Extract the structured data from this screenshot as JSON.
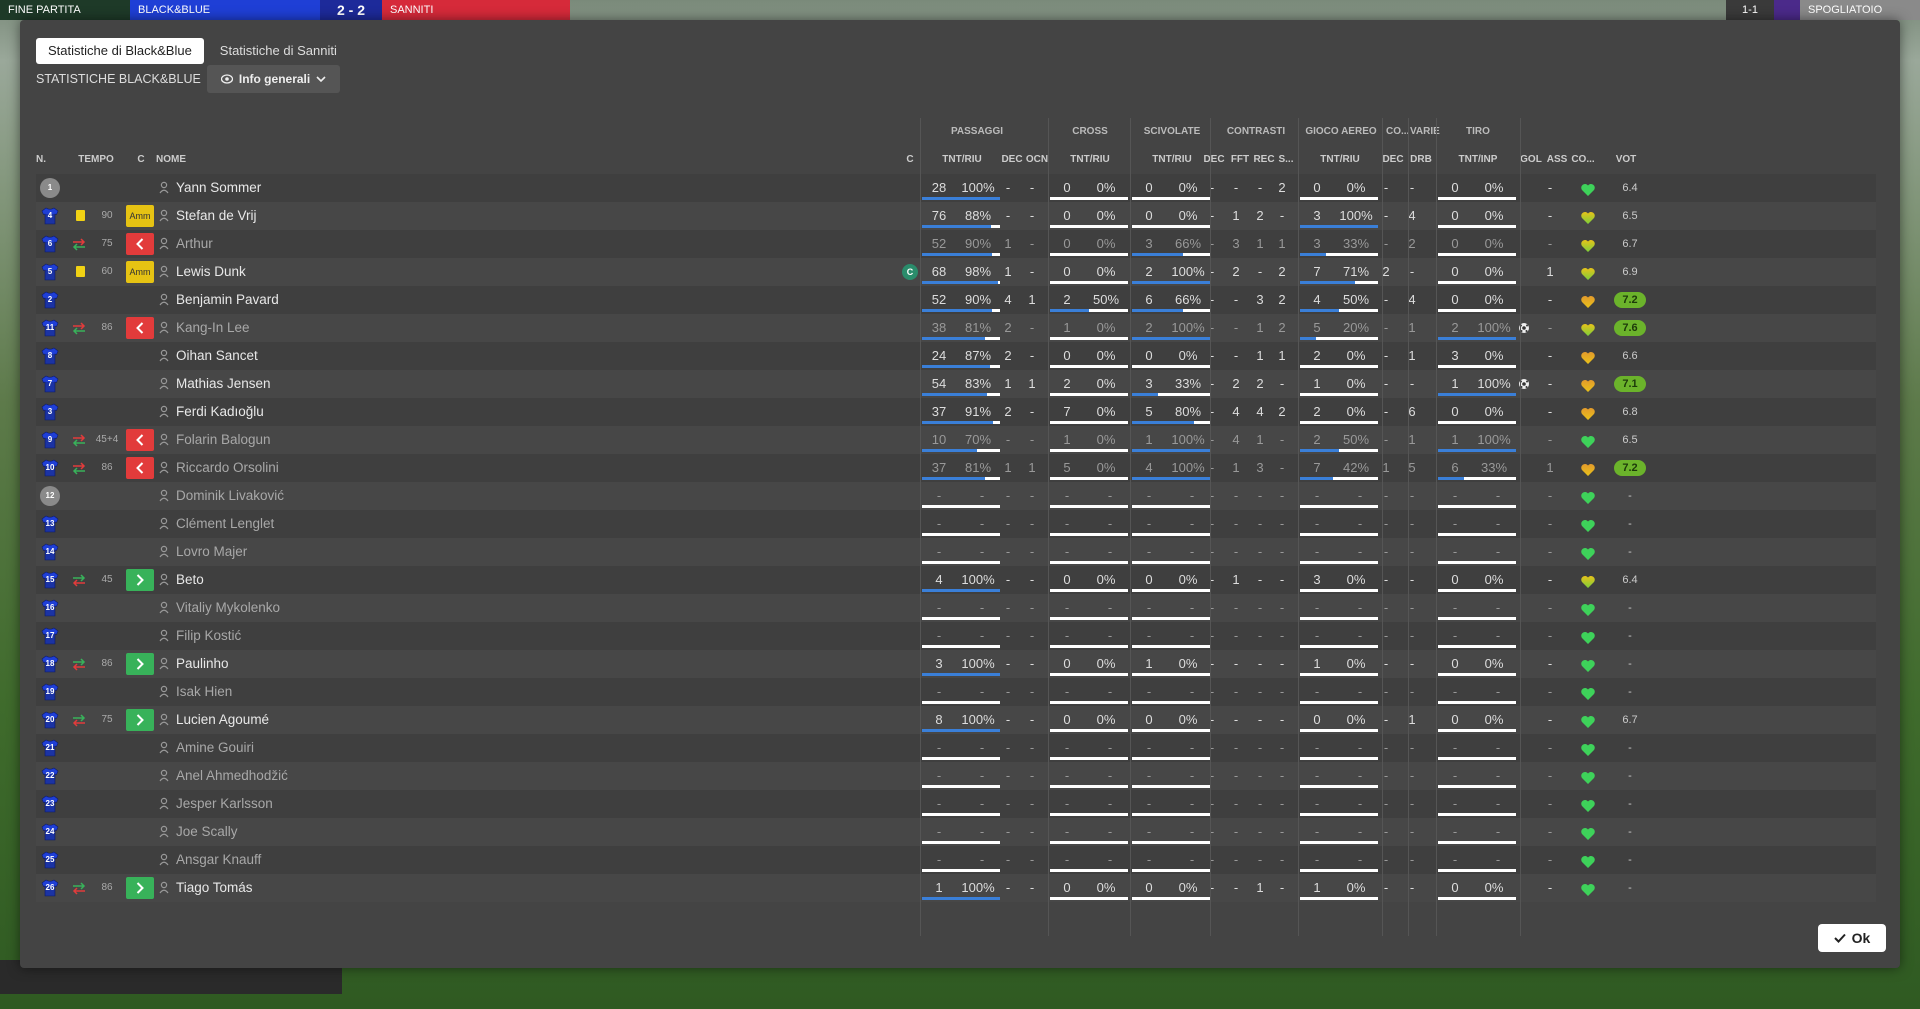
{
  "topbar": {
    "left_label": "FINE PARTITA",
    "team1": "BLACK&BLUE",
    "score": "2 - 2",
    "team2": "SANNITI",
    "right_label": "SPOGLIATOIO",
    "right_small": "1-1"
  },
  "tabs": [
    {
      "label": "Statistiche di Black&Blue",
      "active": true
    },
    {
      "label": "Statistiche di Sanniti",
      "active": false
    }
  ],
  "section_title": "STATISTICHE BLACK&BLUE",
  "view_dropdown": "Info generali",
  "groups": [
    "PASSAGGI",
    "CROSS",
    "SCIVOLATE",
    "CONTRASTI",
    "GIOCO AEREO",
    "CO...",
    "VARIE",
    "TIRO"
  ],
  "headers": {
    "num": "N.",
    "tempo": "TEMPO",
    "c": "C",
    "nome": "NOME",
    "c2": "C",
    "pass": "TNT/RIU",
    "dec1": "DEC",
    "ocn": "OCN",
    "cross": "TNT/RIU",
    "sciv": "TNT/RIU",
    "cdec": "DEC",
    "fft": "FFT",
    "rec": "REC",
    "s": "S...",
    "aereo": "TNT/RIU",
    "codec": "DEC",
    "drb": "DRB",
    "tiro": "TNT/INP",
    "gol": "GOL",
    "ass": "ASS",
    "con": "CO...",
    "vot": "VOT"
  },
  "players": [
    {
      "n": "1",
      "kind": "gk",
      "card": "",
      "sub": "",
      "min": "",
      "status": "",
      "name": "Yann Sommer",
      "dim": false,
      "cap": "",
      "pt": "28",
      "pp": "100%",
      "pf": 1.0,
      "dec1": "-",
      "ocn": "-",
      "ct": "0",
      "cp": "0%",
      "cf": 0,
      "st": "0",
      "sp": "0%",
      "sf": 0,
      "cdec": "-",
      "fft": "-",
      "rec": "-",
      "s": "2",
      "at": "0",
      "ap": "0%",
      "af": 0,
      "codec": "-",
      "drb": "-",
      "tt": "0",
      "tp": "0%",
      "tf": 0,
      "gol": "",
      "ass": "-",
      "heart": "green",
      "vot": "6.4",
      "good": false
    },
    {
      "n": "4",
      "kind": "shirt",
      "card": "y",
      "sub": "",
      "min": "90",
      "status": "amm",
      "name": "Stefan de Vrij",
      "dim": false,
      "cap": "",
      "pt": "76",
      "pp": "88%",
      "pf": 0.88,
      "dec1": "-",
      "ocn": "-",
      "ct": "0",
      "cp": "0%",
      "cf": 0,
      "st": "0",
      "sp": "0%",
      "sf": 0,
      "cdec": "-",
      "fft": "1",
      "rec": "2",
      "s": "-",
      "at": "3",
      "ap": "100%",
      "af": 1,
      "codec": "-",
      "drb": "4",
      "tt": "0",
      "tp": "0%",
      "tf": 0,
      "gol": "",
      "ass": "-",
      "heart": "yellow",
      "vot": "6.5",
      "good": false
    },
    {
      "n": "6",
      "kind": "shirt",
      "card": "",
      "sub": "out",
      "min": "75",
      "status": "out",
      "name": "Arthur",
      "dim": true,
      "cap": "",
      "pt": "52",
      "pp": "90%",
      "pf": 0.9,
      "dec1": "1",
      "ocn": "-",
      "ct": "0",
      "cp": "0%",
      "cf": 0,
      "st": "3",
      "sp": "66%",
      "sf": 0.66,
      "cdec": "-",
      "fft": "3",
      "rec": "1",
      "s": "1",
      "at": "3",
      "ap": "33%",
      "af": 0.33,
      "codec": "-",
      "drb": "2",
      "tt": "0",
      "tp": "0%",
      "tf": 0,
      "gol": "",
      "ass": "-",
      "heart": "yellow",
      "vot": "6.7",
      "good": false
    },
    {
      "n": "5",
      "kind": "shirt",
      "card": "y",
      "sub": "",
      "min": "60",
      "status": "amm",
      "name": "Lewis Dunk",
      "dim": false,
      "cap": "C",
      "pt": "68",
      "pp": "98%",
      "pf": 0.98,
      "dec1": "1",
      "ocn": "-",
      "ct": "0",
      "cp": "0%",
      "cf": 0,
      "st": "2",
      "sp": "100%",
      "sf": 1,
      "cdec": "-",
      "fft": "2",
      "rec": "-",
      "s": "2",
      "at": "7",
      "ap": "71%",
      "af": 0.71,
      "codec": "2",
      "drb": "-",
      "tt": "0",
      "tp": "0%",
      "tf": 0,
      "gol": "",
      "ass": "1",
      "heart": "yellow",
      "vot": "6.9",
      "good": false
    },
    {
      "n": "2",
      "kind": "shirt",
      "card": "",
      "sub": "",
      "min": "",
      "status": "",
      "name": "Benjamin Pavard",
      "dim": false,
      "cap": "",
      "pt": "52",
      "pp": "90%",
      "pf": 0.9,
      "dec1": "4",
      "ocn": "1",
      "ct": "2",
      "cp": "50%",
      "cf": 0.5,
      "st": "6",
      "sp": "66%",
      "sf": 0.66,
      "cdec": "-",
      "fft": "-",
      "rec": "3",
      "s": "2",
      "at": "4",
      "ap": "50%",
      "af": 0.5,
      "codec": "-",
      "drb": "4",
      "tt": "0",
      "tp": "0%",
      "tf": 0,
      "gol": "",
      "ass": "-",
      "heart": "orange",
      "vot": "7.2",
      "good": true
    },
    {
      "n": "11",
      "kind": "shirt",
      "card": "",
      "sub": "out",
      "min": "86",
      "status": "out",
      "name": "Kang-In Lee",
      "dim": true,
      "cap": "",
      "pt": "38",
      "pp": "81%",
      "pf": 0.81,
      "dec1": "2",
      "ocn": "-",
      "ct": "1",
      "cp": "0%",
      "cf": 0,
      "st": "2",
      "sp": "100%",
      "sf": 1,
      "cdec": "-",
      "fft": "-",
      "rec": "1",
      "s": "2",
      "at": "5",
      "ap": "20%",
      "af": 0.2,
      "codec": "-",
      "drb": "1",
      "tt": "2",
      "tp": "100%",
      "tf": 1,
      "gol": "ball",
      "ass": "-",
      "heart": "yellow",
      "vot": "7.6",
      "good": true
    },
    {
      "n": "8",
      "kind": "shirt",
      "card": "",
      "sub": "",
      "min": "",
      "status": "",
      "name": "Oihan Sancet",
      "dim": false,
      "cap": "",
      "pt": "24",
      "pp": "87%",
      "pf": 0.87,
      "dec1": "2",
      "ocn": "-",
      "ct": "0",
      "cp": "0%",
      "cf": 0,
      "st": "0",
      "sp": "0%",
      "sf": 0,
      "cdec": "-",
      "fft": "-",
      "rec": "1",
      "s": "1",
      "at": "2",
      "ap": "0%",
      "af": 0,
      "codec": "-",
      "drb": "1",
      "tt": "3",
      "tp": "0%",
      "tf": 0,
      "gol": "",
      "ass": "-",
      "heart": "orange",
      "vot": "6.6",
      "good": false
    },
    {
      "n": "7",
      "kind": "shirt",
      "card": "",
      "sub": "",
      "min": "",
      "status": "",
      "name": "Mathias Jensen",
      "dim": false,
      "cap": "",
      "pt": "54",
      "pp": "83%",
      "pf": 0.83,
      "dec1": "1",
      "ocn": "1",
      "ct": "2",
      "cp": "0%",
      "cf": 0,
      "st": "3",
      "sp": "33%",
      "sf": 0.33,
      "cdec": "-",
      "fft": "2",
      "rec": "2",
      "s": "-",
      "at": "1",
      "ap": "0%",
      "af": 0,
      "codec": "-",
      "drb": "-",
      "tt": "1",
      "tp": "100%",
      "tf": 1,
      "gol": "ball",
      "ass": "-",
      "heart": "orange",
      "vot": "7.1",
      "good": true
    },
    {
      "n": "3",
      "kind": "shirt",
      "card": "",
      "sub": "",
      "min": "",
      "status": "",
      "name": "Ferdi Kadıoğlu",
      "dim": false,
      "cap": "",
      "pt": "37",
      "pp": "91%",
      "pf": 0.91,
      "dec1": "2",
      "ocn": "-",
      "ct": "7",
      "cp": "0%",
      "cf": 0,
      "st": "5",
      "sp": "80%",
      "sf": 0.8,
      "cdec": "-",
      "fft": "4",
      "rec": "4",
      "s": "2",
      "at": "2",
      "ap": "0%",
      "af": 0,
      "codec": "-",
      "drb": "6",
      "tt": "0",
      "tp": "0%",
      "tf": 0,
      "gol": "",
      "ass": "-",
      "heart": "orange",
      "vot": "6.8",
      "good": false
    },
    {
      "n": "9",
      "kind": "shirt",
      "card": "",
      "sub": "out",
      "min": "45+4",
      "status": "out",
      "name": "Folarin Balogun",
      "dim": true,
      "cap": "",
      "pt": "10",
      "pp": "70%",
      "pf": 0.7,
      "dec1": "-",
      "ocn": "-",
      "ct": "1",
      "cp": "0%",
      "cf": 0,
      "st": "1",
      "sp": "100%",
      "sf": 1,
      "cdec": "-",
      "fft": "4",
      "rec": "1",
      "s": "-",
      "at": "2",
      "ap": "50%",
      "af": 0.5,
      "codec": "-",
      "drb": "1",
      "tt": "1",
      "tp": "100%",
      "tf": 1,
      "gol": "",
      "ass": "-",
      "heart": "green",
      "vot": "6.5",
      "good": false
    },
    {
      "n": "10",
      "kind": "shirt",
      "card": "",
      "sub": "out",
      "min": "86",
      "status": "out",
      "name": "Riccardo Orsolini",
      "dim": true,
      "cap": "",
      "pt": "37",
      "pp": "81%",
      "pf": 0.81,
      "dec1": "1",
      "ocn": "1",
      "ct": "5",
      "cp": "0%",
      "cf": 0,
      "st": "4",
      "sp": "100%",
      "sf": 1,
      "cdec": "-",
      "fft": "1",
      "rec": "3",
      "s": "-",
      "at": "7",
      "ap": "42%",
      "af": 0.42,
      "codec": "1",
      "drb": "5",
      "tt": "6",
      "tp": "33%",
      "tf": 0.33,
      "gol": "",
      "ass": "1",
      "heart": "orange",
      "vot": "7.2",
      "good": true
    },
    {
      "n": "12",
      "kind": "gk",
      "card": "",
      "sub": "",
      "min": "",
      "status": "",
      "name": "Dominik Livaković",
      "dim": true,
      "empty": true,
      "heart": "green",
      "vot": "-"
    },
    {
      "n": "13",
      "kind": "shirt",
      "card": "",
      "sub": "",
      "min": "",
      "status": "",
      "name": "Clément Lenglet",
      "dim": true,
      "empty": true,
      "heart": "green",
      "vot": "-"
    },
    {
      "n": "14",
      "kind": "shirt",
      "card": "",
      "sub": "",
      "min": "",
      "status": "",
      "name": "Lovro Majer",
      "dim": true,
      "empty": true,
      "heart": "green",
      "vot": "-"
    },
    {
      "n": "15",
      "kind": "shirt",
      "card": "",
      "sub": "in",
      "min": "45",
      "status": "in",
      "name": "Beto",
      "dim": false,
      "cap": "",
      "pt": "4",
      "pp": "100%",
      "pf": 1,
      "dec1": "-",
      "ocn": "-",
      "ct": "0",
      "cp": "0%",
      "cf": 0,
      "st": "0",
      "sp": "0%",
      "sf": 0,
      "cdec": "-",
      "fft": "1",
      "rec": "-",
      "s": "-",
      "at": "3",
      "ap": "0%",
      "af": 0,
      "codec": "-",
      "drb": "-",
      "tt": "0",
      "tp": "0%",
      "tf": 0,
      "gol": "",
      "ass": "-",
      "heart": "yellow",
      "vot": "6.4",
      "good": false
    },
    {
      "n": "16",
      "kind": "shirt",
      "card": "",
      "sub": "",
      "min": "",
      "status": "",
      "name": "Vitaliy Mykolenko",
      "dim": true,
      "empty": true,
      "heart": "green",
      "vot": "-"
    },
    {
      "n": "17",
      "kind": "shirt",
      "card": "",
      "sub": "",
      "min": "",
      "status": "",
      "name": "Filip Kostić",
      "dim": true,
      "empty": true,
      "heart": "green",
      "vot": "-"
    },
    {
      "n": "18",
      "kind": "shirt",
      "card": "",
      "sub": "in",
      "min": "86",
      "status": "in",
      "name": "Paulinho",
      "dim": false,
      "cap": "",
      "pt": "3",
      "pp": "100%",
      "pf": 1,
      "dec1": "-",
      "ocn": "-",
      "ct": "0",
      "cp": "0%",
      "cf": 0,
      "st": "1",
      "sp": "0%",
      "sf": 0,
      "cdec": "-",
      "fft": "-",
      "rec": "-",
      "s": "-",
      "at": "1",
      "ap": "0%",
      "af": 0,
      "codec": "-",
      "drb": "-",
      "tt": "0",
      "tp": "0%",
      "tf": 0,
      "gol": "",
      "ass": "-",
      "heart": "green",
      "vot": "-",
      "good": false
    },
    {
      "n": "19",
      "kind": "shirt",
      "card": "",
      "sub": "",
      "min": "",
      "status": "",
      "name": "Isak Hien",
      "dim": true,
      "empty": true,
      "heart": "green",
      "vot": "-"
    },
    {
      "n": "20",
      "kind": "shirt",
      "card": "",
      "sub": "in",
      "min": "75",
      "status": "in",
      "name": "Lucien Agoumé",
      "dim": false,
      "cap": "",
      "pt": "8",
      "pp": "100%",
      "pf": 1,
      "dec1": "-",
      "ocn": "-",
      "ct": "0",
      "cp": "0%",
      "cf": 0,
      "st": "0",
      "sp": "0%",
      "sf": 0,
      "cdec": "-",
      "fft": "-",
      "rec": "-",
      "s": "-",
      "at": "0",
      "ap": "0%",
      "af": 0,
      "codec": "-",
      "drb": "1",
      "tt": "0",
      "tp": "0%",
      "tf": 0,
      "gol": "",
      "ass": "-",
      "heart": "green",
      "vot": "6.7",
      "good": false
    },
    {
      "n": "21",
      "kind": "shirt",
      "card": "",
      "sub": "",
      "min": "",
      "status": "",
      "name": "Amine Gouiri",
      "dim": true,
      "empty": true,
      "heart": "green",
      "vot": "-"
    },
    {
      "n": "22",
      "kind": "shirt",
      "card": "",
      "sub": "",
      "min": "",
      "status": "",
      "name": "Anel Ahmedhodžić",
      "dim": true,
      "empty": true,
      "heart": "green",
      "vot": "-"
    },
    {
      "n": "23",
      "kind": "shirt",
      "card": "",
      "sub": "",
      "min": "",
      "status": "",
      "name": "Jesper Karlsson",
      "dim": true,
      "empty": true,
      "heart": "green",
      "vot": "-"
    },
    {
      "n": "24",
      "kind": "shirt",
      "card": "",
      "sub": "",
      "min": "",
      "status": "",
      "name": "Joe Scally",
      "dim": true,
      "empty": true,
      "heart": "green",
      "vot": "-"
    },
    {
      "n": "25",
      "kind": "shirt",
      "card": "",
      "sub": "",
      "min": "",
      "status": "",
      "name": "Ansgar Knauff",
      "dim": true,
      "empty": true,
      "heart": "green",
      "vot": "-"
    },
    {
      "n": "26",
      "kind": "shirt",
      "card": "",
      "sub": "in",
      "min": "86",
      "status": "in",
      "name": "Tiago Tomás",
      "dim": false,
      "cap": "",
      "pt": "1",
      "pp": "100%",
      "pf": 1,
      "dec1": "-",
      "ocn": "-",
      "ct": "0",
      "cp": "0%",
      "cf": 0,
      "st": "0",
      "sp": "0%",
      "sf": 0,
      "cdec": "-",
      "fft": "-",
      "rec": "1",
      "s": "-",
      "at": "1",
      "ap": "0%",
      "af": 0,
      "codec": "-",
      "drb": "-",
      "tt": "0",
      "tp": "0%",
      "tf": 0,
      "gol": "",
      "ass": "-",
      "heart": "green",
      "vot": "-",
      "good": false
    }
  ],
  "amm_label": "Amm",
  "ok_label": "Ok",
  "colors": {
    "accent_blue": "#3a7fd8",
    "good_rating": "#6bb32b",
    "yellow_card": "#f1d214",
    "sub_out": "#e23b3b",
    "sub_in": "#38b25a"
  }
}
